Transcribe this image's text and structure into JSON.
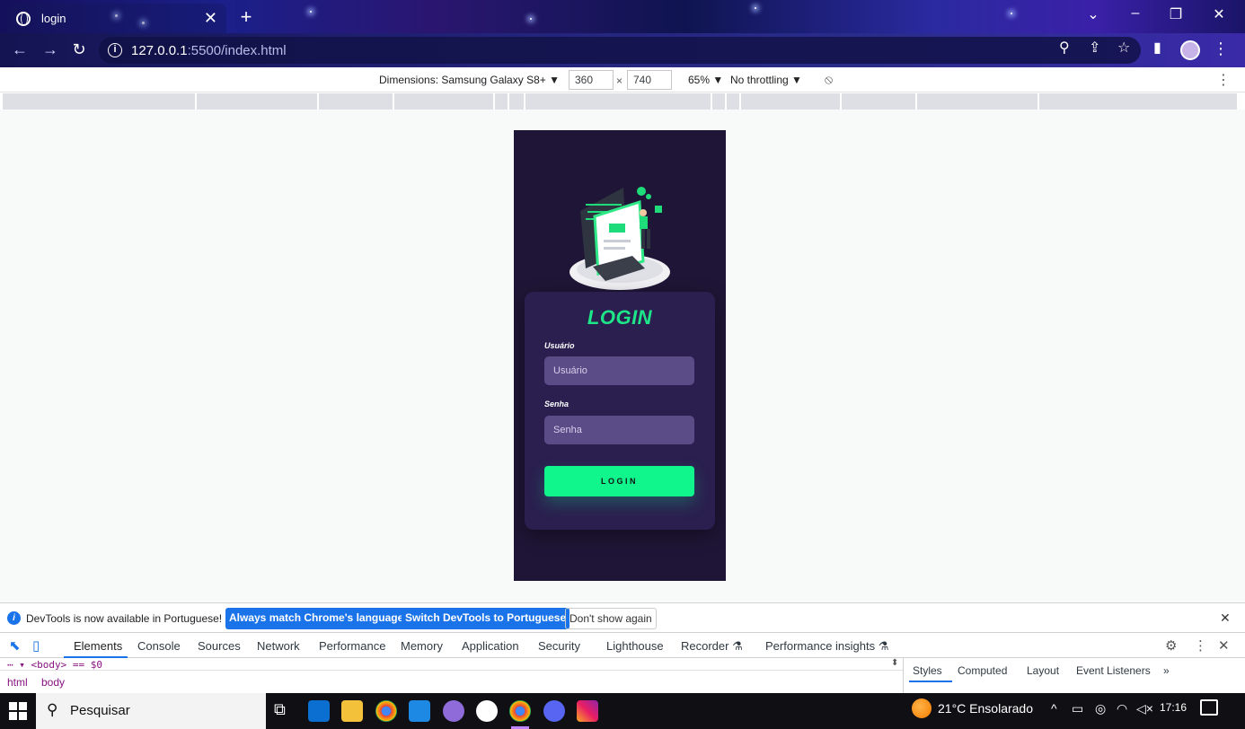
{
  "browser": {
    "tab_title": "login",
    "url_host": "127.0.0.1",
    "url_path": ":5500/index.html"
  },
  "device_toolbar": {
    "dimensions_label": "Dimensions: Samsung Galaxy S8+ ▼",
    "width": "360",
    "height": "740",
    "zoom": "65% ▼",
    "throttling": "No throttling ▼"
  },
  "page": {
    "heading": "LOGIN",
    "username_label": "Usuário",
    "username_placeholder": "Usuário",
    "password_label": "Senha",
    "password_placeholder": "Senha",
    "login_button": "LOGIN",
    "colors": {
      "background": "#1f1536",
      "card": "#2a1f4f",
      "accent": "#10f58c",
      "input": "#5b4b86"
    }
  },
  "devtools": {
    "infobar": {
      "message": "DevTools is now available in Portuguese!",
      "match_button": "Always match Chrome's language",
      "switch_button": "Switch DevTools to Portuguese",
      "dismiss_button": "Don't show again"
    },
    "tabs": [
      "Elements",
      "Console",
      "Sources",
      "Network",
      "Performance",
      "Memory",
      "Application",
      "Security",
      "Lighthouse",
      "Recorder ⚗",
      "Performance insights ⚗"
    ],
    "breadcrumb": [
      "html",
      "body"
    ],
    "dom_snippet": "⋯ ▾ <body> == $0",
    "styles_tabs": [
      "Styles",
      "Computed",
      "Layout",
      "Event Listeners",
      "»"
    ]
  },
  "taskbar": {
    "search_placeholder": "Pesquisar",
    "weather": "21°C  Ensolarado",
    "time": "17:16"
  }
}
